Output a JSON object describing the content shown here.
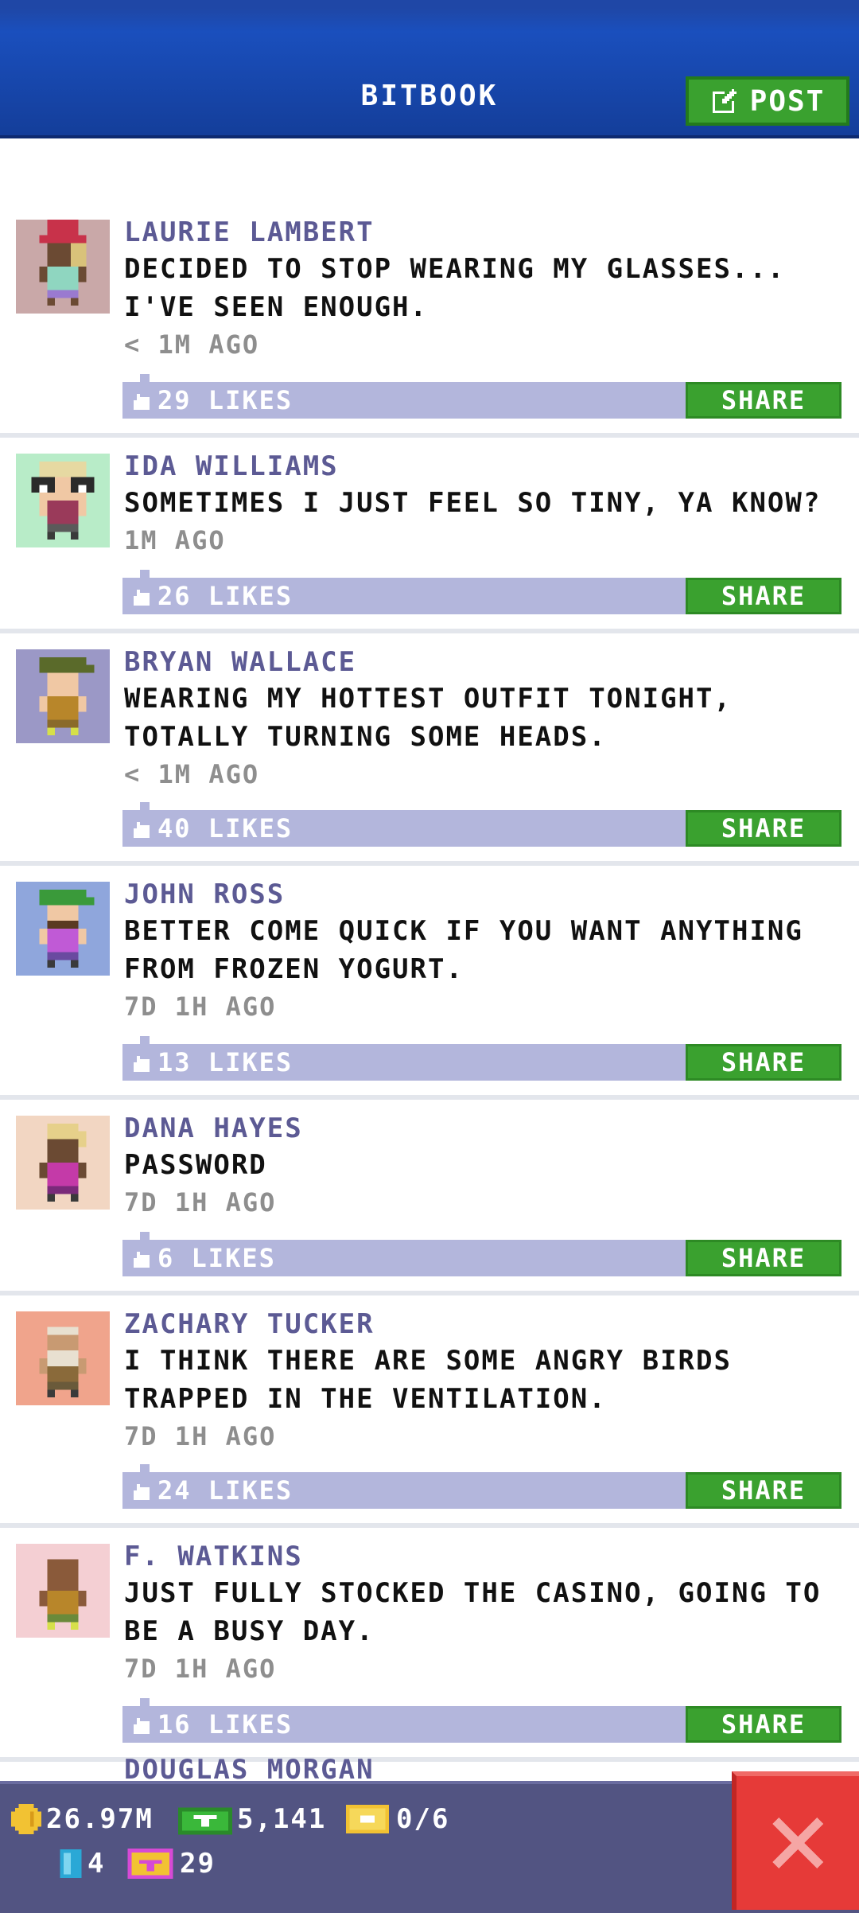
{
  "header": {
    "title": "BITBOOK",
    "post_label": "POST"
  },
  "posts": [
    {
      "name": "LAURIE LAMBERT",
      "text": "DECIDED TO STOP WEARING MY GLASSES... I'VE SEEN ENOUGH.",
      "time": "< 1M AGO",
      "likes": "29 LIKES",
      "share": "SHARE",
      "avatar_bg": "#c9a8a8"
    },
    {
      "name": "IDA WILLIAMS",
      "text": "SOMETIMES I JUST FEEL SO TINY, YA KNOW?",
      "time": "1M AGO",
      "likes": "26 LIKES",
      "share": "SHARE",
      "avatar_bg": "#b8ecc8"
    },
    {
      "name": "BRYAN WALLACE",
      "text": "WEARING MY HOTTEST OUTFIT TONIGHT, TOTALLY TURNING SOME HEADS.",
      "time": "< 1M AGO",
      "likes": "40 LIKES",
      "share": "SHARE",
      "avatar_bg": "#9b98c6"
    },
    {
      "name": "JOHN ROSS",
      "text": "BETTER COME QUICK IF YOU WANT ANYTHING FROM FROZEN YOGURT.",
      "time": "7D 1H AGO",
      "likes": "13 LIKES",
      "share": "SHARE",
      "avatar_bg": "#8fa6dc"
    },
    {
      "name": "DANA HAYES",
      "text": "PASSWORD",
      "time": "7D 1H AGO",
      "likes": "6 LIKES",
      "share": "SHARE",
      "avatar_bg": "#f2d6c2"
    },
    {
      "name": "ZACHARY TUCKER",
      "text": "I THINK THERE ARE SOME ANGRY BIRDS TRAPPED IN THE VENTILATION.",
      "time": "7D 1H AGO",
      "likes": "24 LIKES",
      "share": "SHARE",
      "avatar_bg": "#f0a48c"
    },
    {
      "name": "F. WATKINS",
      "text": "JUST FULLY STOCKED THE CASINO, GOING TO BE A BUSY DAY.",
      "time": "7D 1H AGO",
      "likes": "16 LIKES",
      "share": "SHARE",
      "avatar_bg": "#f4cfd3"
    }
  ],
  "peek_name": "DOUGLAS MORGAN",
  "status": {
    "coins": "26.97M",
    "bux": "5,141",
    "tickets": "0/6",
    "keys": "4",
    "vip": "29"
  },
  "colors": {
    "accent": "#3aa12f",
    "header": "#1a4fbd",
    "bar": "#525482",
    "close": "#e63a38"
  }
}
